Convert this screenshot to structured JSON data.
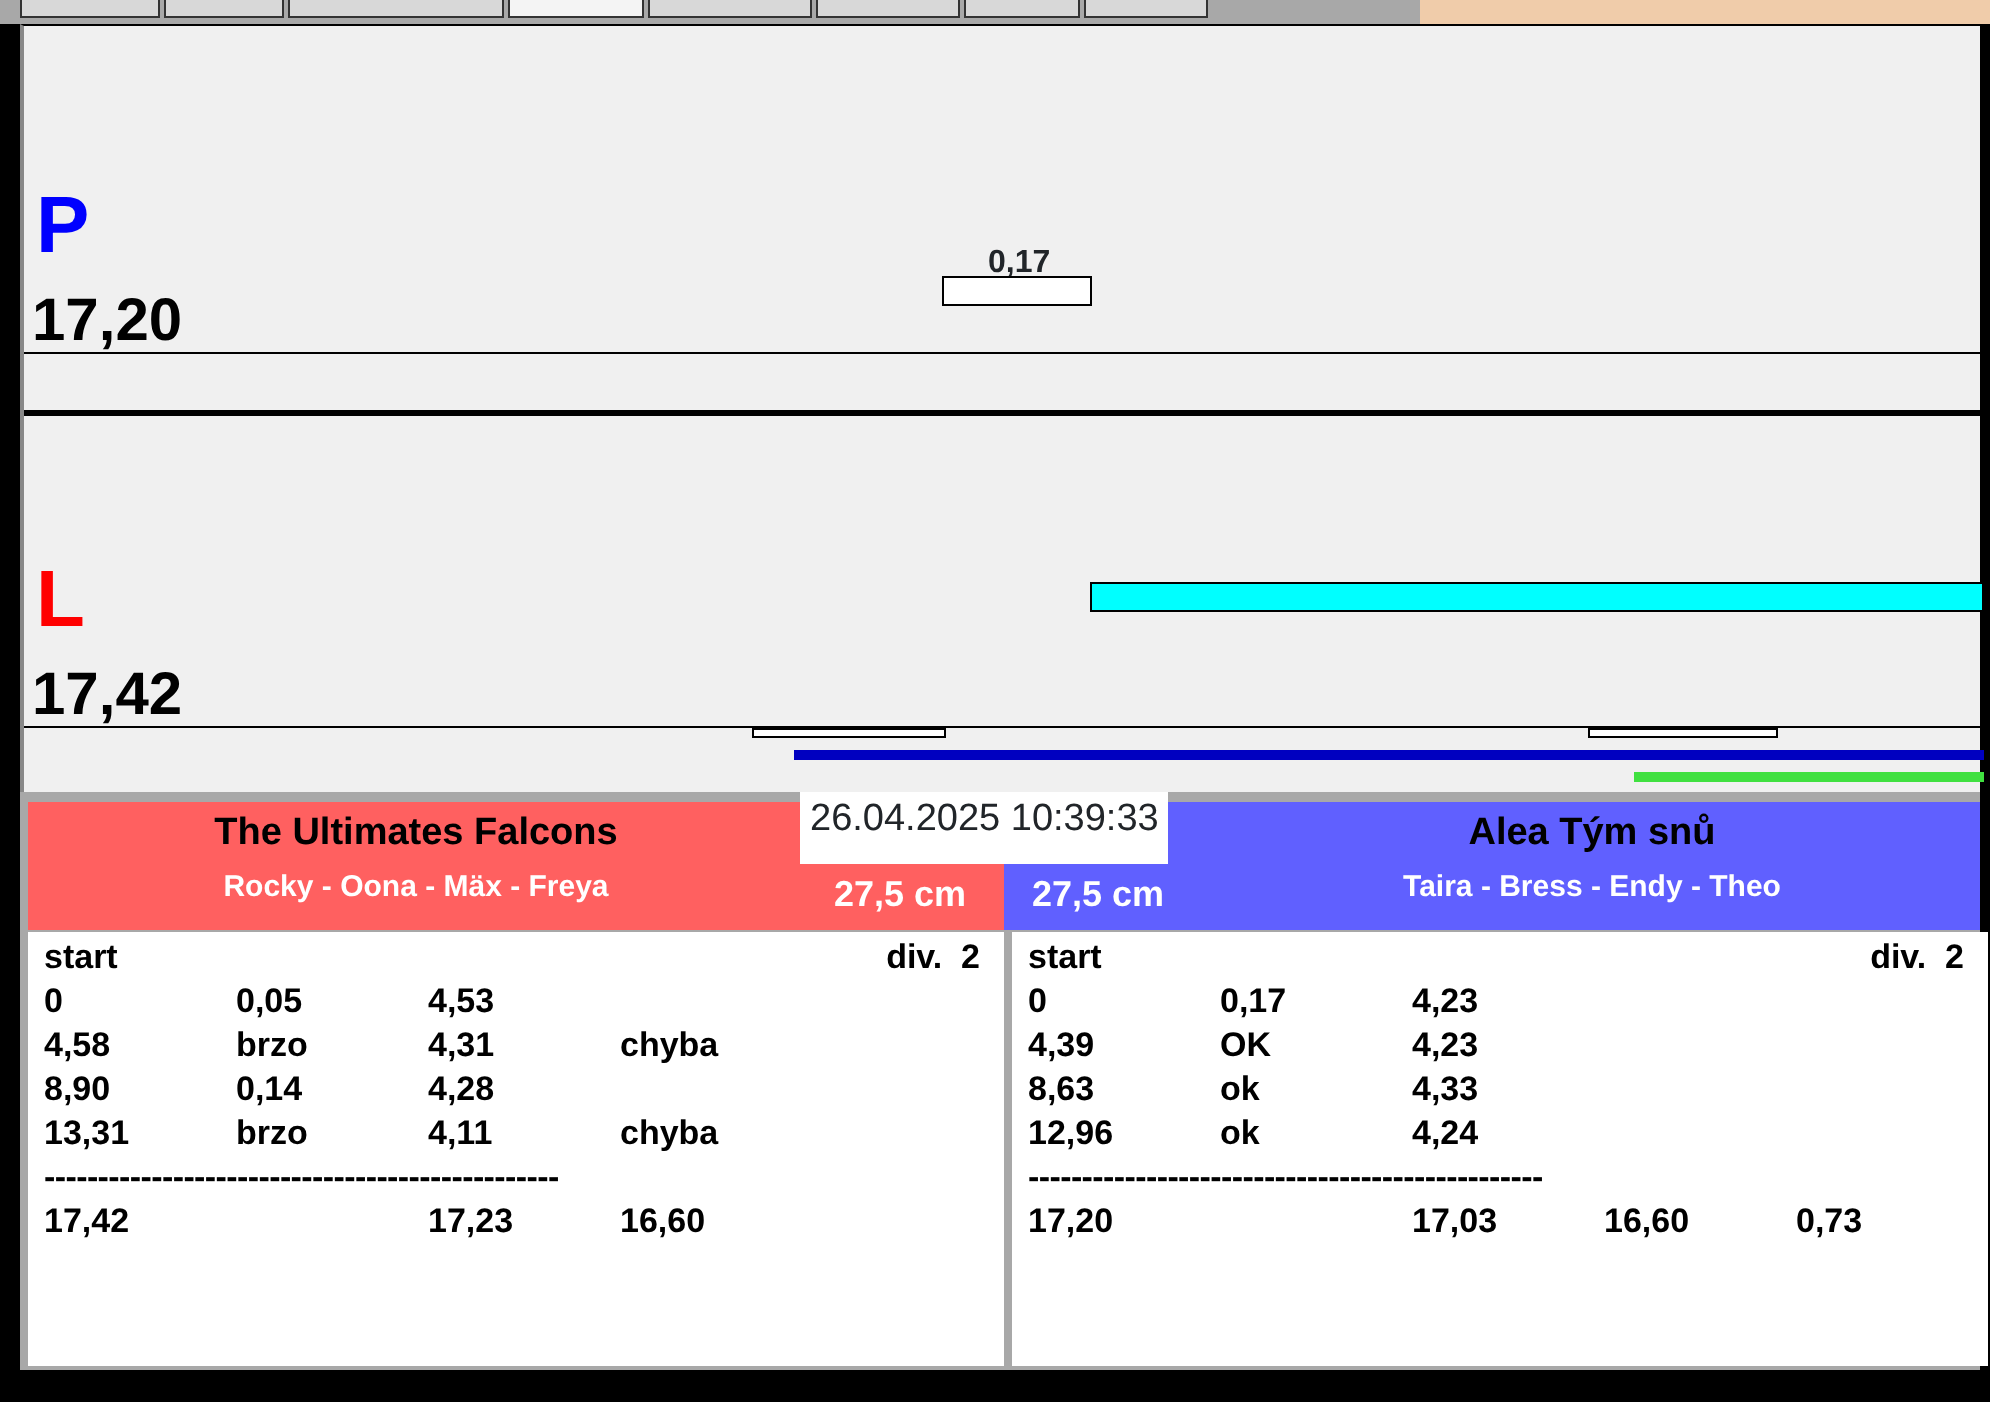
{
  "tabs": [
    {
      "selected": false
    },
    {
      "selected": false
    },
    {
      "selected": false
    },
    {
      "selected": true
    },
    {
      "selected": false
    },
    {
      "selected": false
    },
    {
      "selected": false
    },
    {
      "selected": false
    }
  ],
  "lanes": [
    {
      "letter": "P",
      "color": "#0000ff",
      "time": "17,20",
      "marker_label": "0,17"
    },
    {
      "letter": "L",
      "color": "#ff0000",
      "time": "17,42"
    }
  ],
  "timestamp": "26.04.2025 10:39:33",
  "teams": [
    {
      "name": "The Ultimates Falcons",
      "players": "Rocky - Oona - Mäx - Freya",
      "distance": "27,5 cm",
      "color": "#ff6060",
      "log": {
        "header": "start",
        "division": "div.  2",
        "rows": [
          [
            "0",
            "0,05",
            "4,53"
          ],
          [
            "4,58",
            "brzo",
            "4,31",
            "chyba"
          ],
          [
            "8,90",
            "0,14",
            "4,28"
          ],
          [
            "13,31",
            "brzo",
            "4,11",
            "chyba"
          ]
        ],
        "separator": "------------------------------------------------",
        "totals": {
          "column_1": "17,42",
          "column_3": "17,23",
          "column_4": "16,60"
        }
      }
    },
    {
      "name": "Alea Tým snů",
      "players": "Taira - Bress - Endy - Theo",
      "distance": "27,5 cm",
      "color": "#6060ff",
      "log": {
        "header": "start",
        "division": "div.  2",
        "rows": [
          [
            "0",
            "0,17",
            "4,23"
          ],
          [
            "4,39",
            "OK",
            "4,23"
          ],
          [
            "8,63",
            "ok",
            "4,33"
          ],
          [
            "12,96",
            "ok",
            "4,24"
          ]
        ],
        "separator": "------------------------------------------------",
        "totals": {
          "column_1": "17,20",
          "column_3": "17,03",
          "column_4": "16,60",
          "column_5": "0,73"
        }
      }
    }
  ]
}
